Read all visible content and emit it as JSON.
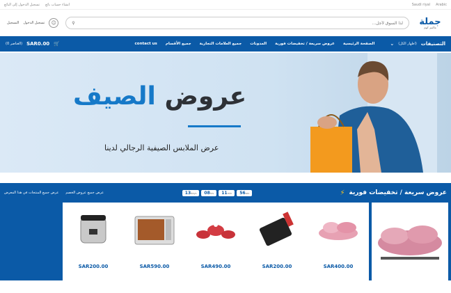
{
  "topbar": {
    "lang": "Arabic",
    "country": "Saudi riyal",
    "create_seller": "انشاء حساب بائع",
    "seller_login": "تسجيل الدخول إلى البائع"
  },
  "header": {
    "logo_main": "جملة",
    "logo_sub": "ماكينز كوم",
    "search_placeholder": "لذا السوق لأجل...",
    "login": "تسجيل الدخول",
    "register": "التسجيل"
  },
  "nav": {
    "categories": "التصنيفات",
    "show_all": "(اظهار الكل)",
    "items": [
      "الصفحة الرئيسية",
      "عروض سريعة / تخفيضات فورية",
      "المدونات",
      "جميع العلامات التجارية",
      "جميع الأقسام",
      "contact us"
    ],
    "cart_total": "SAR0.00",
    "cart_items": "(0 العناصر)"
  },
  "banner": {
    "title_a": "عروض ",
    "title_b": "الصيف",
    "subtitle": "عرض الملابس الصيفية الرجالي لدينا"
  },
  "sale": {
    "title": "عروض سريعة / تخفيضات فورية",
    "timer": [
      {
        "val": "56",
        "unit": "sec"
      },
      {
        "val": "11",
        "unit": "min"
      },
      {
        "val": "08",
        "unit": "hrs"
      },
      {
        "val": "13",
        "unit": "days"
      }
    ],
    "link_all": "عرض جميع عروض الخصم",
    "link_products": "عرض جميع المنتجات في هذا المعرض",
    "products": [
      {
        "name": "pink-cookware-set",
        "price": "SAR400.00"
      },
      {
        "name": "grill-pan",
        "price": "SAR200.00"
      },
      {
        "name": "red-pot-set",
        "price": "SAR490.00"
      },
      {
        "name": "toaster-oven",
        "price": "SAR590.00"
      },
      {
        "name": "pressure-cooker",
        "price": "SAR200.00"
      }
    ]
  },
  "colors": {
    "primary": "#0b5aa7",
    "accent": "#1679c8",
    "bolt": "#f7c31c"
  }
}
